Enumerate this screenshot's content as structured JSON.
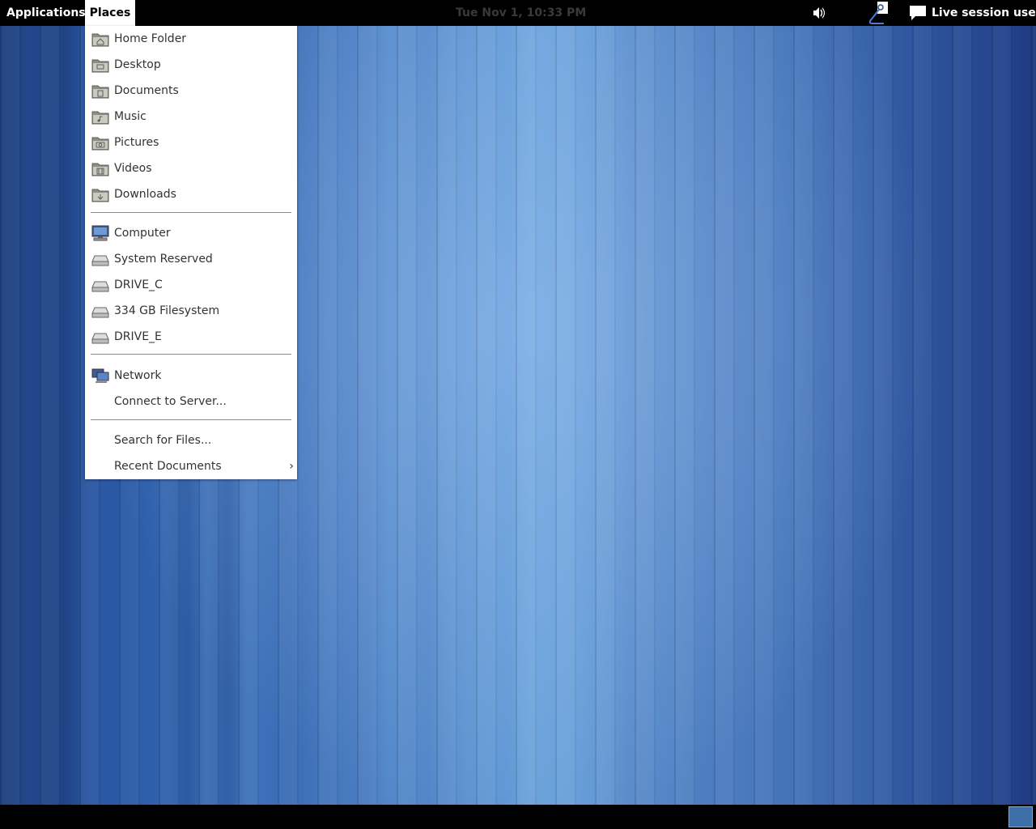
{
  "top_bar": {
    "applications_label": "Applications",
    "places_label": "Places",
    "clock": "Tue Nov  1, 10:33 PM",
    "user_label": "Live session user"
  },
  "places_menu": {
    "bookmarks": [
      {
        "label": "Home Folder",
        "icon": "folder-home-icon"
      },
      {
        "label": "Desktop",
        "icon": "folder-desktop-icon"
      },
      {
        "label": "Documents",
        "icon": "folder-documents-icon"
      },
      {
        "label": "Music",
        "icon": "folder-music-icon"
      },
      {
        "label": "Pictures",
        "icon": "folder-pictures-icon"
      },
      {
        "label": "Videos",
        "icon": "folder-videos-icon"
      },
      {
        "label": "Downloads",
        "icon": "folder-downloads-icon"
      }
    ],
    "devices": [
      {
        "label": "Computer",
        "icon": "computer-icon"
      },
      {
        "label": "System Reserved",
        "icon": "drive-icon"
      },
      {
        "label": "DRIVE_C",
        "icon": "drive-icon"
      },
      {
        "label": "334 GB Filesystem",
        "icon": "drive-icon"
      },
      {
        "label": "DRIVE_E",
        "icon": "drive-icon"
      }
    ],
    "network": [
      {
        "label": "Network",
        "icon": "network-icon"
      },
      {
        "label": "Connect to Server...",
        "icon": ""
      }
    ],
    "search_label": "Search for Files...",
    "recent_label": "Recent Documents",
    "submenu_arrow": "›"
  },
  "colors": {
    "top_bar_bg": "#000000",
    "menu_bg": "#ffffff",
    "desktop_blue": "#4a7cc0"
  }
}
